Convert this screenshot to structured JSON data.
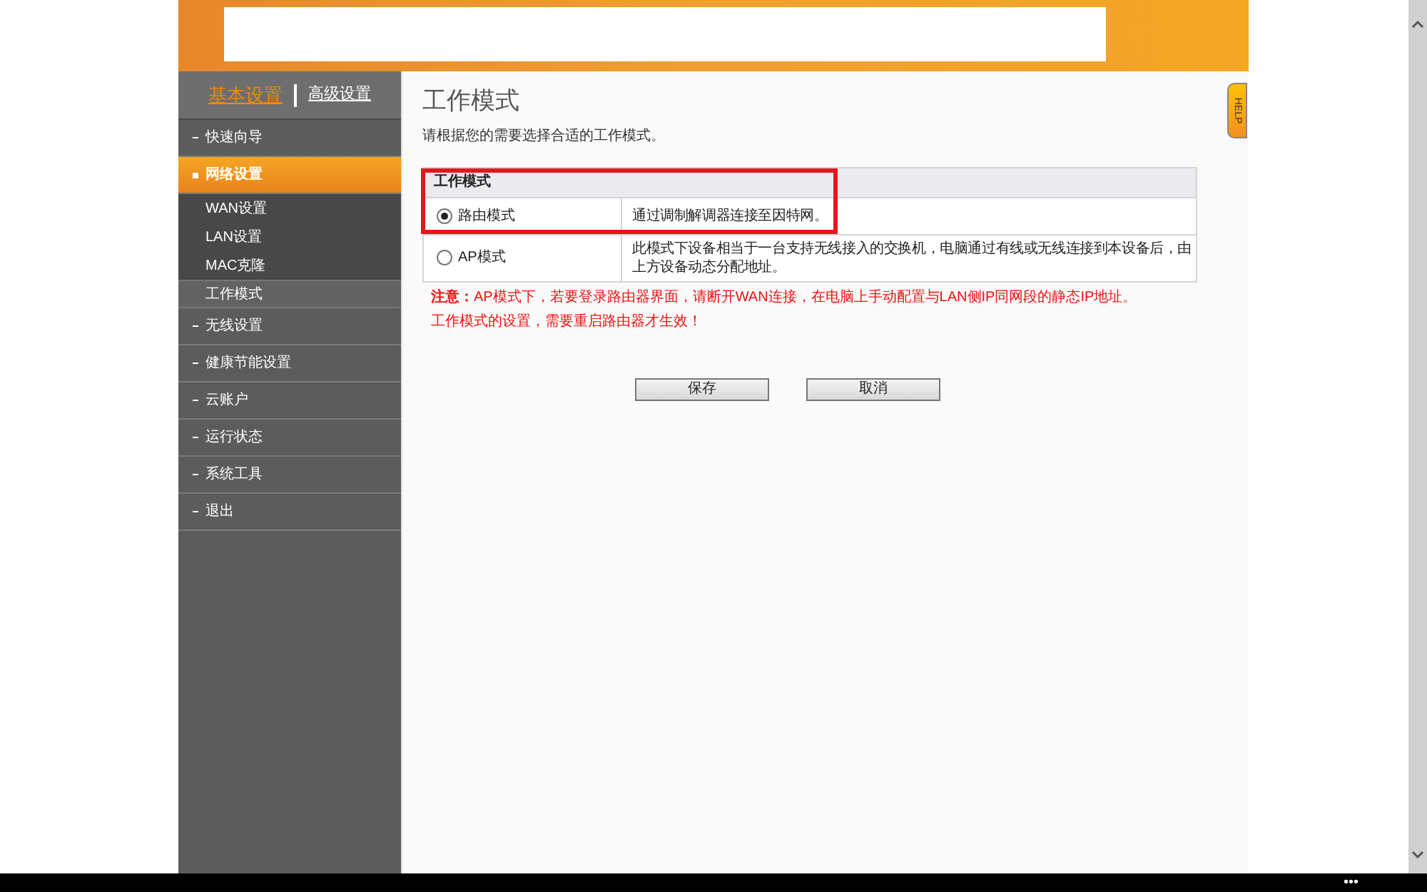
{
  "top_tabs": [
    {
      "label": "基本设置",
      "selected": true
    },
    {
      "label": "高级设置",
      "selected": false
    }
  ],
  "sidebar": {
    "items": [
      {
        "label": "快速向导",
        "expanded": false
      },
      {
        "label": "网络设置",
        "expanded": true,
        "children": [
          {
            "label": "WAN设置",
            "selected": false
          },
          {
            "label": "LAN设置",
            "selected": false
          },
          {
            "label": "MAC克隆",
            "selected": false
          },
          {
            "label": "工作模式",
            "selected": true
          }
        ]
      },
      {
        "label": "无线设置",
        "expanded": false
      },
      {
        "label": "健康节能设置",
        "expanded": false
      },
      {
        "label": "云账户",
        "expanded": false
      },
      {
        "label": "运行状态",
        "expanded": false
      },
      {
        "label": "系统工具",
        "expanded": false
      },
      {
        "label": "退出",
        "expanded": false
      }
    ]
  },
  "page": {
    "title": "工作模式",
    "intro": "请根据您的需要选择合适的工作模式。",
    "table": {
      "heading": "工作模式",
      "rows": [
        {
          "label": "路由模式",
          "selected": true,
          "description": "通过调制解调器连接至因特网。"
        },
        {
          "label": "AP模式",
          "selected": false,
          "description": "此模式下设备相当于一台支持无线接入的交换机，电脑通过有线或无线连接到本设备后，由上方设备动态分配地址。"
        }
      ]
    },
    "notes": [
      "**注意：**AP模式下，若要登录路由器界面，请断开WAN连接，在电脑上手动配置与LAN侧IP同网段的静态IP地址。",
      "工作模式的设置，需要重启路由器才生效！"
    ],
    "buttons": [
      "保存",
      "取消"
    ]
  },
  "help_tab": "HELP",
  "taskbar_dots": "•••"
}
